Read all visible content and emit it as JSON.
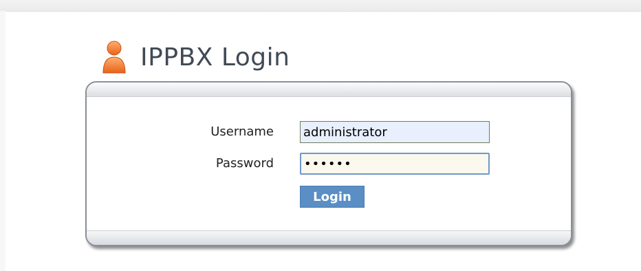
{
  "header": {
    "title": "IPPBX Login",
    "icon": "user-icon"
  },
  "form": {
    "username_label": "Username",
    "username_value": "administrator",
    "password_label": "Password",
    "password_value": "123456",
    "login_label": "Login"
  },
  "colors": {
    "icon_orange": "#f0782a",
    "title_text": "#404a55",
    "button_bg": "#5a8ec4",
    "username_bg": "#e8effd",
    "password_bg": "#fbf8ee",
    "password_border": "#6e98cc"
  }
}
